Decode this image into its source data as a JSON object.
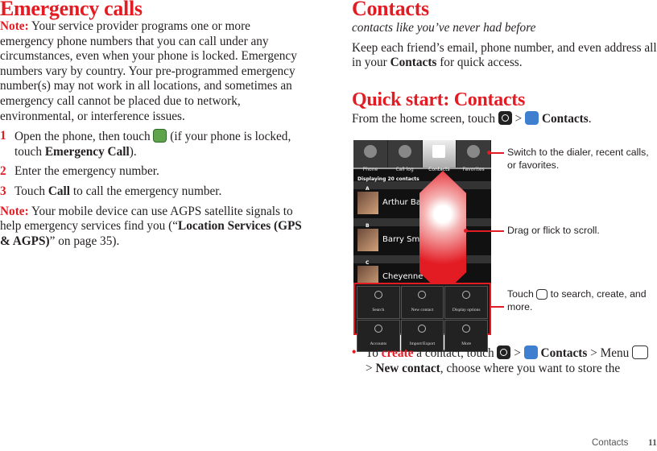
{
  "left": {
    "title": "Emergency calls",
    "note_label": "Note:",
    "note_text": " Your service provider programs one or more emergency phone numbers that you can call under any circumstances, even when your phone is locked. Emergency numbers vary by country. Your pre-programmed emergency number(s) may not work in all locations, and sometimes an emergency call cannot be placed due to network, environmental, or interference issues.",
    "steps": [
      {
        "num": "1",
        "a": "Open the phone, then touch ",
        "b": " (if your phone is locked, touch ",
        "bold": "Emergency Call",
        "c": ")."
      },
      {
        "num": "2",
        "text": "Enter the emergency number."
      },
      {
        "num": "3",
        "a": "Touch ",
        "bold": "Call",
        "c": " to call the emergency number."
      }
    ],
    "note2_label": "Note:",
    "note2_a": " Your mobile device can use AGPS satellite signals to help emergency services find you (“",
    "note2_bold": "Location Services (GPS & AGPS)",
    "note2_c": "” on page 35)."
  },
  "right": {
    "title": "Contacts",
    "subtitle": "contacts like you’ve never had before",
    "intro_a": "Keep each friend’s email, phone number, and even address all in your ",
    "intro_bold": "Contacts",
    "intro_c": " for quick access.",
    "quick_title": "Quick start: Contacts",
    "quick_a": "From the home screen, touch ",
    "gt": " > ",
    "quick_bold": "Contacts",
    "quick_c": ".",
    "bullet": {
      "a": "To ",
      "red": "create",
      "b": " a contact, touch ",
      "bold1": "Contacts",
      "c": " > Menu ",
      "d": "> ",
      "bold2": "New contact",
      "e": ", choose where you want to store the"
    }
  },
  "phone": {
    "tabs": [
      "Phone",
      "Call log",
      "Contacts",
      "Favorites"
    ],
    "active_tab": "Contacts",
    "displaying": "Displaying 20 contacts",
    "sections": [
      {
        "letter": "A",
        "name": "Arthur Baudo"
      },
      {
        "letter": "B",
        "name": "Barry Smyth"
      },
      {
        "letter": "C",
        "name": "Cheyenne Medina"
      }
    ],
    "menu": [
      "Search",
      "New contact",
      "Display options",
      "Accounts",
      "Import/Export",
      "More"
    ]
  },
  "callouts": {
    "tabs": "Switch to the dialer, recent calls, or favorites.",
    "scroll": "Drag or flick to scroll.",
    "menu_a": "Touch ",
    "menu_b": " to search, create, and more."
  },
  "footer": {
    "section": "Contacts",
    "page": "11"
  },
  "colors": {
    "accent": "#e31b23"
  }
}
